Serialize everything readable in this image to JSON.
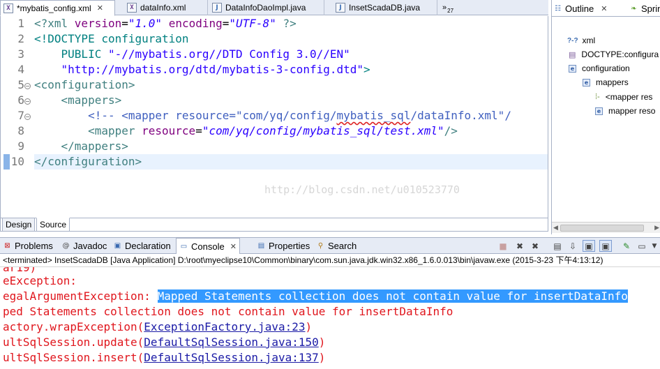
{
  "editor_tabs": [
    {
      "label": "*mybatis_config.xml",
      "icon": "xml-file-icon",
      "active": true
    },
    {
      "label": "dataInfo.xml",
      "icon": "xml-file-icon",
      "active": false
    },
    {
      "label": "DataInfoDaoImpl.java",
      "icon": "java-file-icon",
      "active": false
    },
    {
      "label": "InsetScadaDB.java",
      "icon": "java-file-icon",
      "active": false
    }
  ],
  "editor_overflow": {
    "glyph": "»",
    "count": "27"
  },
  "editor": {
    "line_numbers": [
      "1",
      "2",
      "3",
      "4",
      "5",
      "6",
      "7",
      "8",
      "9",
      "10"
    ],
    "lines": {
      "l1": {
        "open": "<?xml ",
        "a1": "version",
        "eq1": "=",
        "v1": "\"1.0\"",
        "sp": " ",
        "a2": "encoding",
        "eq2": "=",
        "v2": "\"UTF-8\"",
        "close": " ?>"
      },
      "l2": {
        "text": "<!DOCTYPE configuration"
      },
      "l3": {
        "pub": "    PUBLIC ",
        "id": "\"-//mybatis.org//DTD Config 3.0//EN\""
      },
      "l4": {
        "indent": "    ",
        "uri": "\"http://mybatis.org/dtd/mybatis-3-config.dtd\"",
        "close": ">"
      },
      "l5": {
        "text": "<configuration>"
      },
      "l6": {
        "text": "    <mappers>"
      },
      "l7": {
        "indent": "        ",
        "comment_open": "<!-- <mapper resource=\"",
        "path_a": "com/yq/config/",
        "path_b": "mybatis_sql",
        "path_c": "/dataInfo.xml\"/"
      },
      "l8": {
        "indent": "        ",
        "open": "<mapper ",
        "attr": "resource",
        "eq": "=",
        "val": "\"com/yq/config/mybatis_sql/test.xml\"",
        "close": "/>"
      },
      "l9": {
        "text": "    </mappers>"
      },
      "l10": {
        "text": "</configuration>"
      }
    },
    "watermark": "http://blog.csdn.net/u010523770"
  },
  "design_source_tabs": [
    {
      "label": "Design",
      "active": false
    },
    {
      "label": "Source",
      "active": true
    }
  ],
  "outline": {
    "tabs": [
      {
        "label": "Outline",
        "icon": "outline-icon",
        "active": true
      },
      {
        "label": "Sprin",
        "icon": "spring-icon",
        "active": false
      }
    ],
    "tree": [
      {
        "label": "xml",
        "icon": "processing-instruction-icon",
        "level": 0
      },
      {
        "label": "DOCTYPE:configura",
        "icon": "doctype-icon",
        "level": 0
      },
      {
        "label": "configuration",
        "icon": "element-icon",
        "level": 0
      },
      {
        "label": "mappers",
        "icon": "element-icon",
        "level": 1
      },
      {
        "label": "<mapper res",
        "icon": "comment-icon",
        "level": 2
      },
      {
        "label": "mapper reso",
        "icon": "element-icon",
        "level": 2
      }
    ]
  },
  "views_tabs": [
    {
      "label": "Problems",
      "icon": "problems-icon",
      "active": false
    },
    {
      "label": "Javadoc",
      "icon": "javadoc-icon",
      "active": false
    },
    {
      "label": "Declaration",
      "icon": "declaration-icon",
      "active": false
    },
    {
      "label": "Console",
      "icon": "console-icon",
      "active": true
    },
    {
      "label": "Properties",
      "icon": "properties-icon",
      "active": false
    },
    {
      "label": "Search",
      "icon": "search-icon",
      "active": false
    }
  ],
  "console": {
    "status": "<terminated> InsetScadaDB [Java Application] D:\\root\\myeclipse10\\Common\\binary\\com.sun.java.jdk.win32.x86_1.6.0.013\\bin\\javaw.exe (2015-3-23 下午4:13:12)",
    "lines": {
      "o0": {
        "text": "ar19)"
      },
      "o1": {
        "text": "eException:"
      },
      "o2": {
        "prefix": "egalArgumentException: ",
        "selected": "Mapped Statements collection does not contain value for insertDataInfo"
      },
      "o3": {
        "text": "ped Statements collection does not contain value for insertDataInfo"
      },
      "o4": {
        "prefix": "actory.wrapException(",
        "link": "ExceptionFactory.java:23",
        "suffix": ")"
      },
      "o5": {
        "prefix": "ultSqlSession.update(",
        "link": "DefaultSqlSession.java:150",
        "suffix": ")"
      },
      "o6": {
        "prefix": "ultSqlSession.insert(",
        "link": "DefaultSqlSession.java:137",
        "suffix": ")"
      }
    }
  },
  "colors": {
    "tab_bar": "#e6ebf5",
    "error_text": "#e0161d",
    "selection": "#3399ff",
    "link": "#1a1aa6",
    "current_line": "#e8f2fe"
  }
}
